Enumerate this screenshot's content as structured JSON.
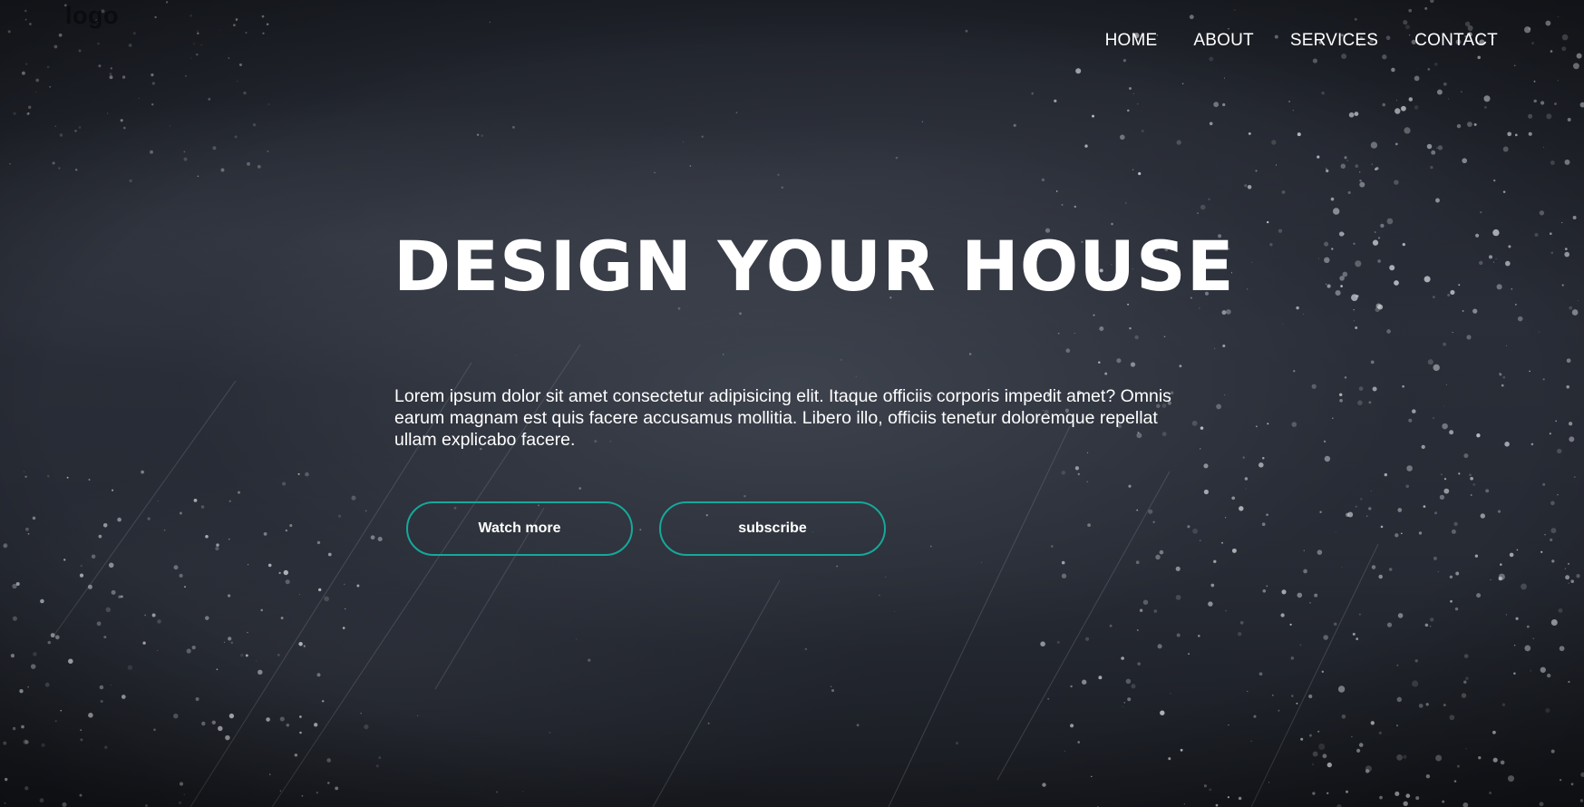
{
  "header": {
    "logo": "logo",
    "nav": [
      {
        "label": "HOME"
      },
      {
        "label": "ABOUT"
      },
      {
        "label": "SERVICES"
      },
      {
        "label": "CONTACT"
      }
    ]
  },
  "hero": {
    "title": "DESIGN YOUR HOUSE",
    "description": "Lorem ipsum dolor sit amet consectetur adipisicing elit. Itaque officiis corporis impedit amet? Omnis earum magnam est quis facere accusamus mollitia. Libero illo, officiis tenetur doloremque repellat ullam explicabo facere.",
    "buttons": {
      "watch_more": "Watch more",
      "subscribe": "subscribe"
    }
  },
  "colors": {
    "background": "#262a33",
    "button_border": "#16a89a",
    "text": "#ffffff"
  }
}
